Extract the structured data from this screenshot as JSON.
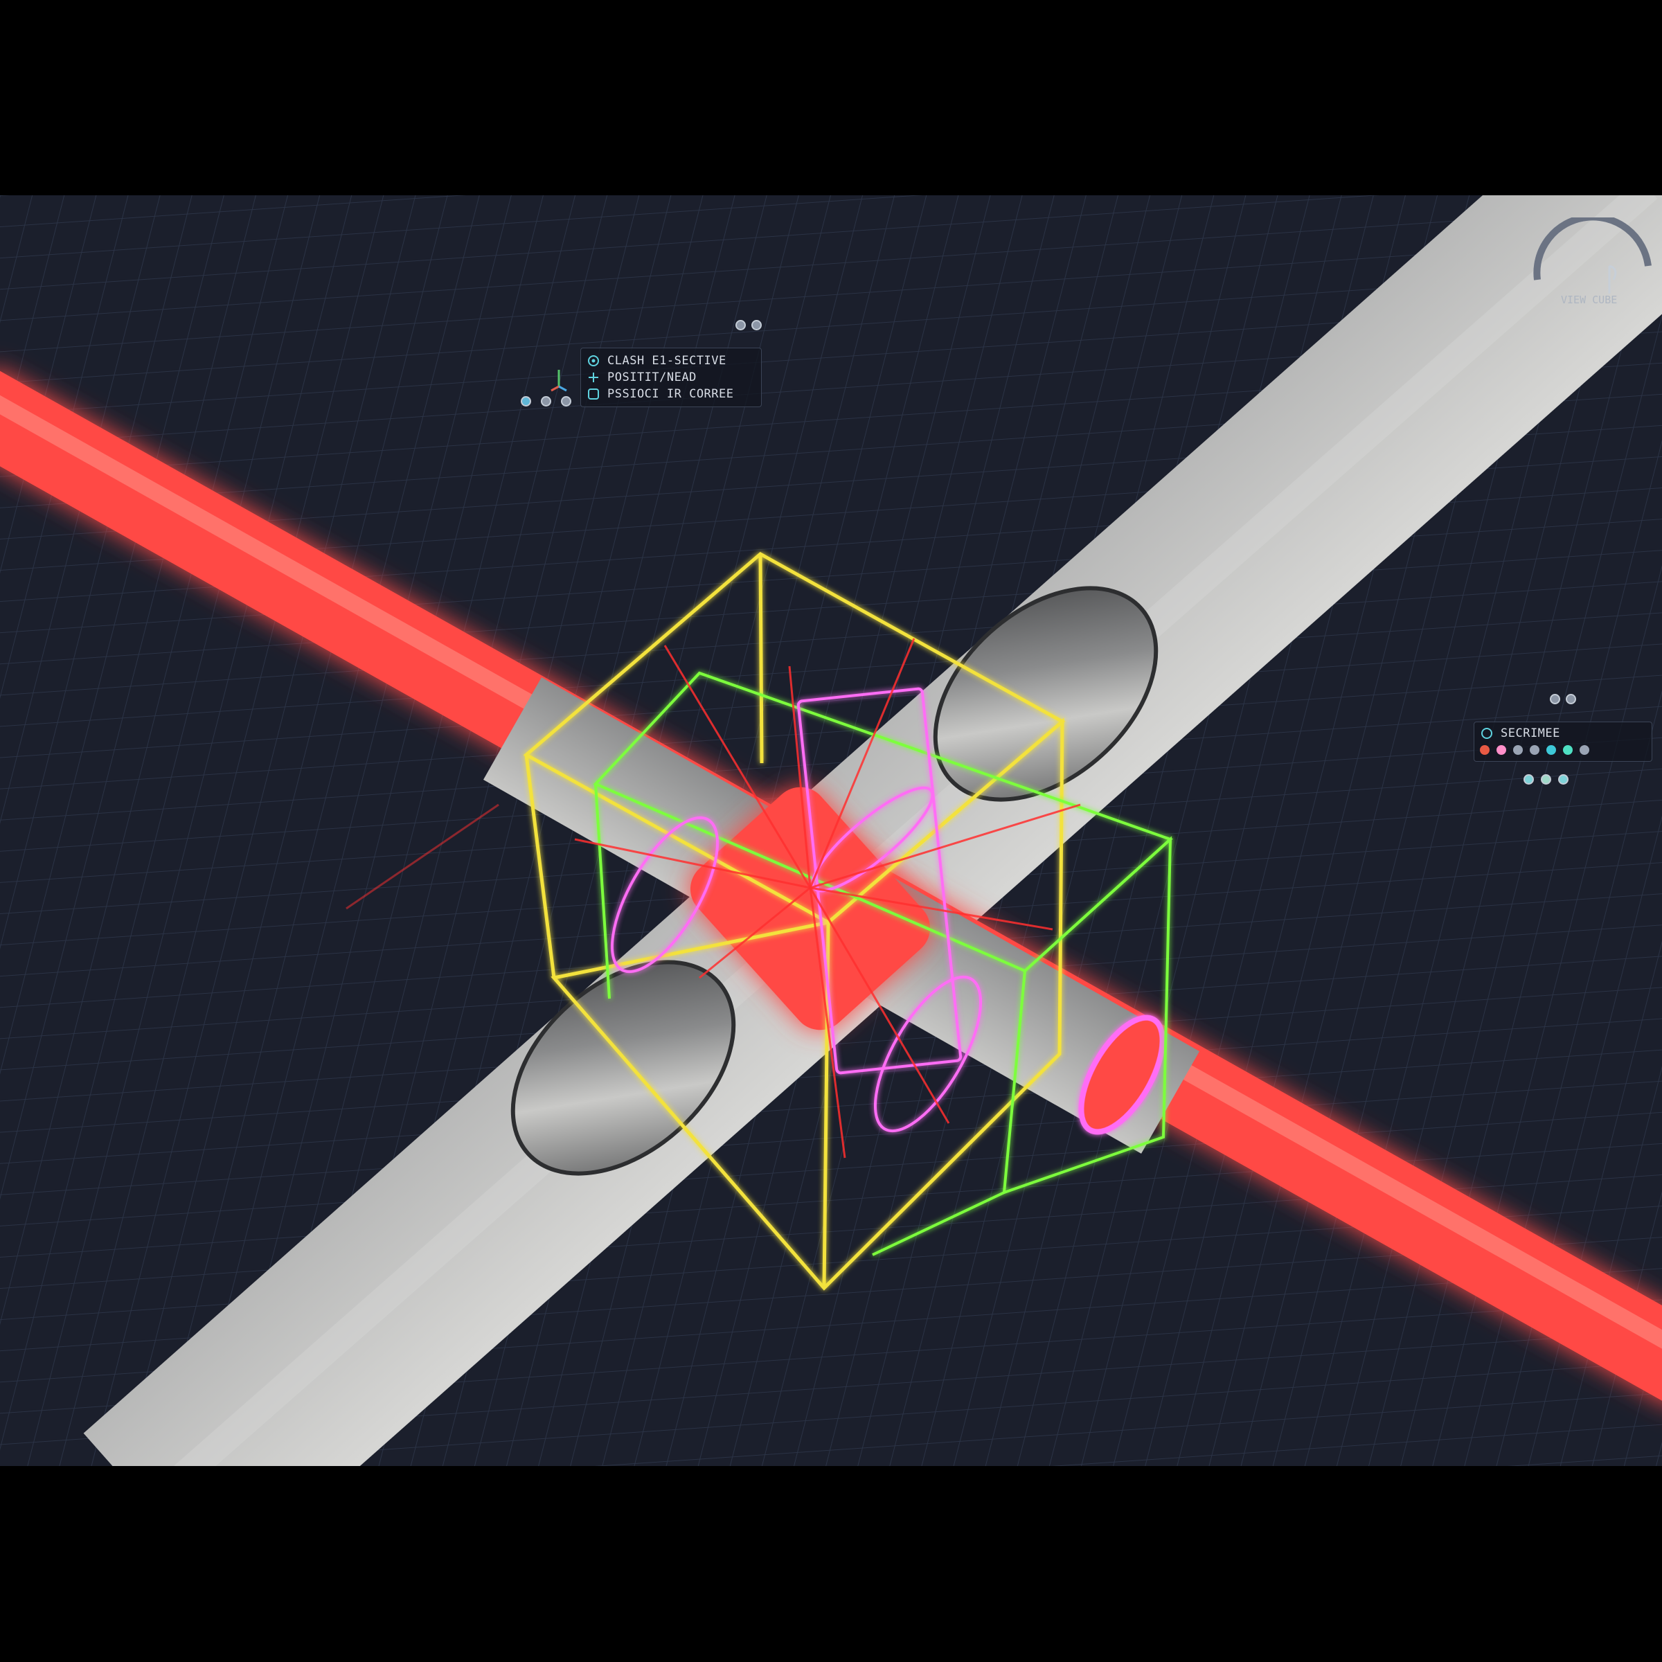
{
  "viewport": {
    "background": "#1b1f2c",
    "grid_color": "#2b3346"
  },
  "colors": {
    "pipe_red": "#ff4a45",
    "pipe_steel": "#7d7f80",
    "box_yellow": "#f3e23c",
    "box_green": "#7dff3d",
    "box_magenta": "#ff6df5"
  },
  "clash_panel": {
    "lines": [
      {
        "icon": "clash-icon",
        "text": "CLASH E1-SECTIVE"
      },
      {
        "icon": "position-icon",
        "text": "POSITIT/NEAD"
      },
      {
        "icon": "process-icon",
        "text": "PSSIOCI IR CORREE"
      }
    ],
    "controls": [
      "visibility-icon",
      "settings-icon",
      "close-icon"
    ],
    "toggles": [
      "pin-icon",
      "pin-icon"
    ]
  },
  "secondary_panel": {
    "title": "SECRIMEE",
    "swatches": [
      "#e85a44",
      "#ff8fc9",
      "#9aa4b4",
      "#9aa4b4",
      "#3ec9d8",
      "#4fe0c3",
      "#9aa4b4"
    ],
    "controls": [
      "#7ed2d8",
      "#9fd8c8",
      "#7ed2d8"
    ],
    "toggles": [
      "pin-icon",
      "pin-icon"
    ]
  },
  "view_cube": {
    "label": "VIEW CUBE"
  }
}
